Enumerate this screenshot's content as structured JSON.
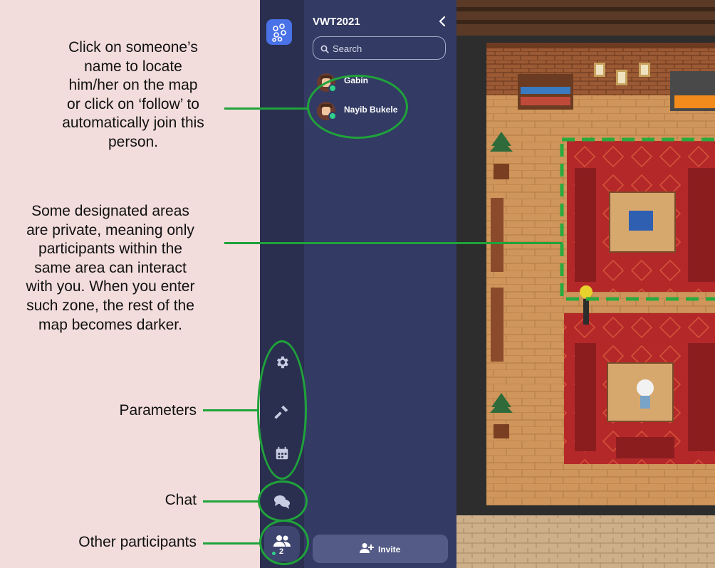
{
  "annotations": {
    "names": [
      "Click on someone’s",
      "name to locate",
      "him/her on the map",
      "or click on ‘follow’ to",
      "automatically join this",
      "person."
    ],
    "private_areas": [
      "Some designated areas",
      "are private, meaning only",
      "participants within the",
      "same area can interact",
      "with you. When you enter",
      "such zone, the rest of the",
      "map becomes darker."
    ],
    "parameters": "Parameters",
    "chat": "Chat",
    "other_participants": "Other participants"
  },
  "panel": {
    "title": "VWT2021",
    "search_placeholder": "Search",
    "people": [
      {
        "name": "Gabin",
        "online": true
      },
      {
        "name": "Nayib Bukele",
        "online": true
      }
    ],
    "invite_label": "Invite"
  },
  "rail": {
    "icons": [
      "app-logo-icon",
      "gear-icon",
      "hammer-icon",
      "calendar-icon",
      "chat-icon",
      "participants-icon"
    ],
    "participants_count": "2"
  },
  "colors": {
    "annotation_green": "#1fa33a",
    "panel_bg": "#333a64",
    "rail_bg": "#2a2f4f",
    "online_status": "#2fd28b",
    "logo_blue": "#4a72e8"
  }
}
